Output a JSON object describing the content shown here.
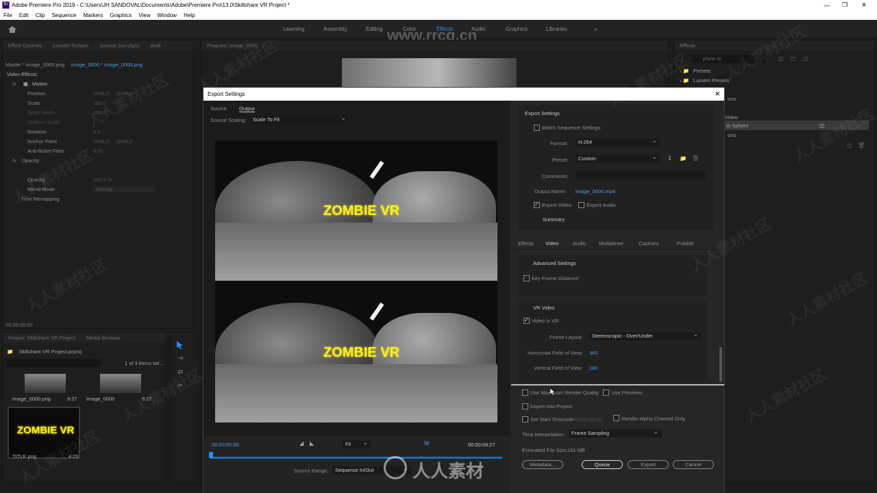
{
  "window": {
    "title": "Adobe Premiere Pro 2019 - C:\\Users\\JH SANDOVAL\\Documents\\Adobe\\Premiere Pro\\13.0\\Skillshare VR Project *",
    "app_icon": "Pr"
  },
  "menu": [
    "File",
    "Edit",
    "Clip",
    "Sequence",
    "Markers",
    "Graphics",
    "View",
    "Window",
    "Help"
  ],
  "workspaces": {
    "items": [
      "Learning",
      "Assembly",
      "Editing",
      "Color",
      "Effects",
      "Audio",
      "Graphics",
      "Libraries"
    ],
    "active": "Effects",
    "more": "»"
  },
  "watermark": {
    "site": "www.rrcg.cn",
    "logo_text": "人人素材",
    "tile": "人人素材社区"
  },
  "effect_controls": {
    "tabs": [
      "Effect Controls",
      "Lumetri Scopes",
      "Source: (no clips)",
      "Audi"
    ],
    "master": "Master * image_0000.png",
    "clip": "image_0000 * image_0000.png",
    "section": "Video Effects",
    "motion": "Motion",
    "params": [
      {
        "name": "Position",
        "v1": "2048.0",
        "v2": "2048.0"
      },
      {
        "name": "Scale",
        "v1": "100.0",
        "v2": ""
      },
      {
        "name": "Scale Width",
        "v1": "100.0",
        "v2": ""
      },
      {
        "name": "Uniform Scale",
        "v1": "",
        "v2": ""
      },
      {
        "name": "Rotation",
        "v1": "0.0",
        "v2": ""
      },
      {
        "name": "Anchor Point",
        "v1": "2048.0",
        "v2": "2048.0"
      },
      {
        "name": "Anti-flicker Filter",
        "v1": "0.00",
        "v2": ""
      }
    ],
    "opacity_group": "Opacity",
    "opacity": {
      "name": "Opacity",
      "value": "100.0 %"
    },
    "blend": {
      "name": "Blend Mode",
      "value": "Normal"
    },
    "time_remap": "Time Remapping",
    "timecode": "00:00:00:00"
  },
  "program": {
    "tab": "Program: image_0000"
  },
  "project": {
    "tabs": [
      "Project: Skillshare VR Project",
      "Media Browser"
    ],
    "file": "Skillshare VR Project.prproj",
    "count": "1 of 3 items sel...",
    "items": [
      {
        "name": "image_0000.png",
        "dur": "9:27"
      },
      {
        "name": "image_0000",
        "dur": "9:27"
      },
      {
        "name": "TITLE.png",
        "dur": "4:29"
      }
    ],
    "thumb_text": "ZOMBIE VR"
  },
  "effects_panel": {
    "tab": "Effects",
    "search": "plane to",
    "items": [
      "Presets",
      "Lumetri Presets",
      "ons",
      "Video",
      "to Sphere",
      "ons"
    ]
  },
  "dialog": {
    "title": "Export Settings",
    "close": "×",
    "left_tabs": [
      "Source",
      "Output"
    ],
    "active_left_tab": "Output",
    "source_scaling_label": "Source Scaling:",
    "source_scaling": "Scale To Fit",
    "preview_text": "ZOMBIE VR",
    "timecode_in": "00:00:00:00",
    "timecode_out": "00:00:09:27",
    "fit": "Fit",
    "source_range_label": "Source Range:",
    "source_range": "Sequence In/Out",
    "progress": 0.0,
    "export_settings": {
      "header": "Export Settings",
      "match_sequence": "Match Sequence Settings",
      "format_label": "Format:",
      "format": "H.264",
      "preset_label": "Preset:",
      "preset": "Custom",
      "comments_label": "Comments:",
      "comments": "",
      "output_label": "Output Name:",
      "output": "image_0000.mp4",
      "export_video": "Export Video",
      "export_audio": "Export Audio",
      "summary": "Summary"
    },
    "right_tabs": [
      "Effects",
      "Video",
      "Audio",
      "Multiplexer",
      "Captions",
      "Publish"
    ],
    "active_right_tab": "Video",
    "advanced": {
      "header": "Advanced Settings",
      "keyframe": "Key Frame Distance:"
    },
    "vr": {
      "header": "VR Video",
      "video_is_vr": "Video Is VR",
      "layout_label": "Frame Layout:",
      "layout": "Stereoscopic - Over/Under",
      "hfov_label": "Horizontal Field of View:",
      "hfov": "360",
      "vfov_label": "Vertical Field of View:",
      "vfov": "180"
    },
    "bottom": {
      "max_render": "Use Maximum Render Quality",
      "previews": "Use Previews",
      "import": "Import Into Project",
      "start_tc": "Set Start Timecode",
      "start_tc_value": "00;00;00;00",
      "alpha": "Render Alpha Channel Only",
      "interp_label": "Time Interpolation:",
      "interp": "Frame Sampling",
      "filesize_label": "Estimated File Size:",
      "filesize": "181 MB"
    },
    "buttons": {
      "metadata": "Metadata...",
      "queue": "Queue",
      "export": "Export",
      "cancel": "Cancel"
    }
  },
  "colors": {
    "accent": "#2d8ceb",
    "title_yellow": "#f5f028"
  }
}
